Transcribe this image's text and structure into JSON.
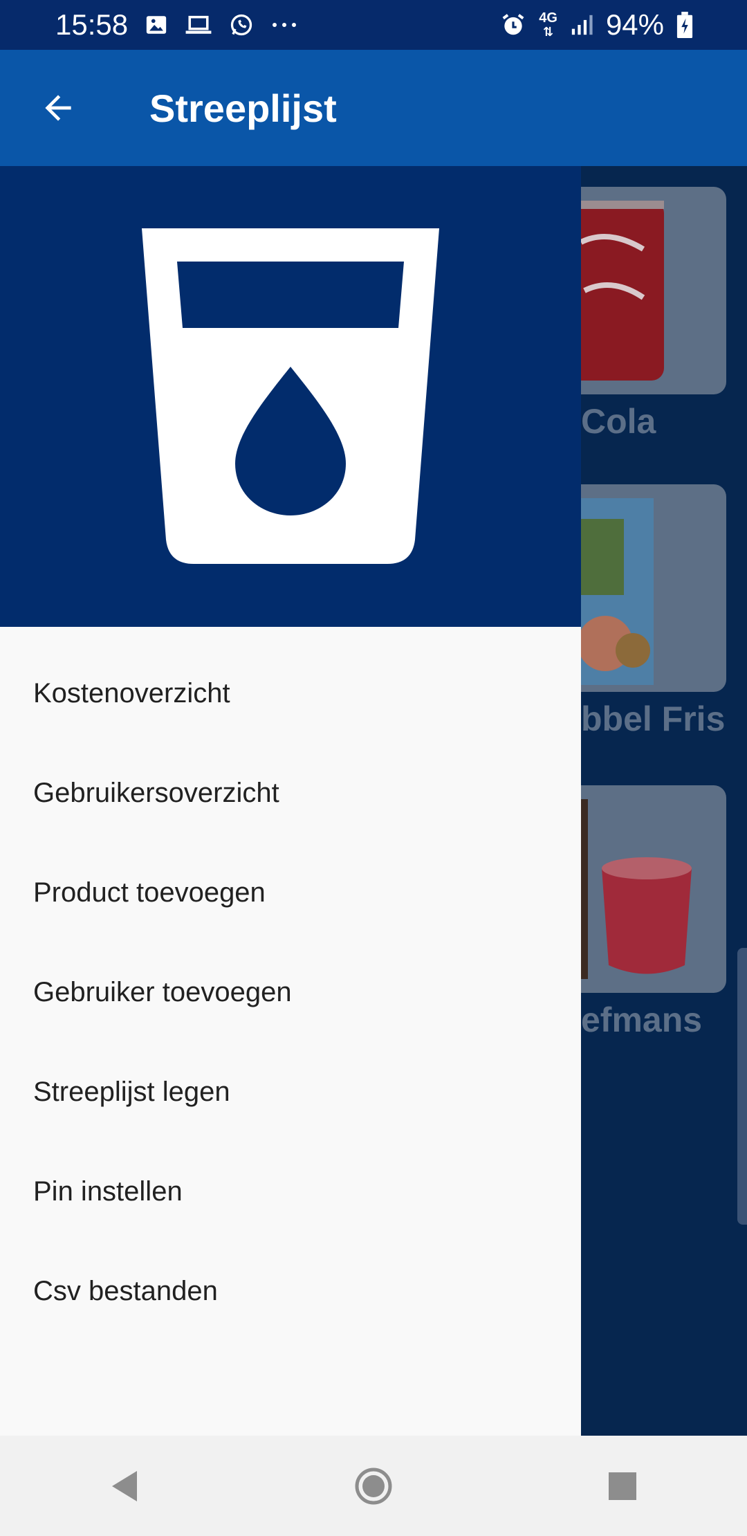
{
  "status_bar": {
    "time": "15:58",
    "network": "4G",
    "battery": "94%"
  },
  "app_bar": {
    "title": "Streeplijst"
  },
  "products": [
    {
      "name": "Cola"
    },
    {
      "name": "bbel Fris"
    },
    {
      "name": "efmans"
    }
  ],
  "drawer": {
    "menu": [
      {
        "label": "Kostenoverzicht"
      },
      {
        "label": "Gebruikersoverzicht"
      },
      {
        "label": "Product toevoegen"
      },
      {
        "label": "Gebruiker toevoegen"
      },
      {
        "label": "Streeplijst legen"
      },
      {
        "label": "Pin instellen"
      },
      {
        "label": "Csv bestanden"
      }
    ]
  },
  "colors": {
    "status_bar": "#062a6b",
    "app_bar": "#0a56a8",
    "drawer_header": "#022c6c",
    "drawer_bg": "#f9f9f9"
  }
}
